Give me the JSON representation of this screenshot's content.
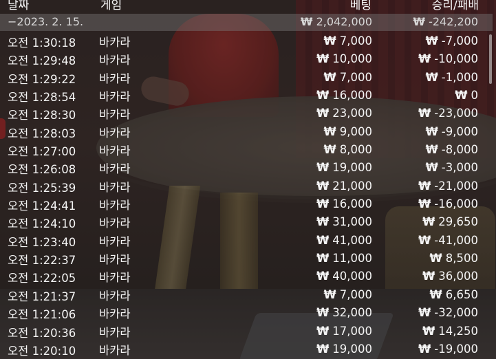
{
  "header": {
    "date_label": "날짜",
    "game_label": "게임",
    "bet_label": "베팅",
    "pl_label": "승리/패배"
  },
  "summary": {
    "date": "−2023. 2. 15.",
    "bet_currency": "₩",
    "bet": "2,042,000",
    "pl_currency": "₩",
    "pl": "-242,200"
  },
  "currency_symbol": "₩",
  "rows": [
    {
      "time": "오전 1:30:18",
      "game": "바카라",
      "bet": "7,000",
      "pl": "-7,000"
    },
    {
      "time": "오전 1:29:48",
      "game": "바카라",
      "bet": "10,000",
      "pl": "-10,000"
    },
    {
      "time": "오전 1:29:22",
      "game": "바카라",
      "bet": "7,000",
      "pl": "-1,000"
    },
    {
      "time": "오전 1:28:54",
      "game": "바카라",
      "bet": "16,000",
      "pl": "0"
    },
    {
      "time": "오전 1:28:30",
      "game": "바카라",
      "bet": "23,000",
      "pl": "-23,000"
    },
    {
      "time": "오전 1:28:03",
      "game": "바카라",
      "bet": "9,000",
      "pl": "-9,000"
    },
    {
      "time": "오전 1:27:00",
      "game": "바카라",
      "bet": "8,000",
      "pl": "-8,000"
    },
    {
      "time": "오전 1:26:08",
      "game": "바카라",
      "bet": "19,000",
      "pl": "-3,000"
    },
    {
      "time": "오전 1:25:39",
      "game": "바카라",
      "bet": "21,000",
      "pl": "-21,000"
    },
    {
      "time": "오전 1:24:41",
      "game": "바카라",
      "bet": "16,000",
      "pl": "-16,000"
    },
    {
      "time": "오전 1:24:10",
      "game": "바카라",
      "bet": "31,000",
      "pl": "29,650"
    },
    {
      "time": "오전 1:23:40",
      "game": "바카라",
      "bet": "41,000",
      "pl": "-41,000"
    },
    {
      "time": "오전 1:22:37",
      "game": "바카라",
      "bet": "11,000",
      "pl": "8,500"
    },
    {
      "time": "오전 1:22:05",
      "game": "바카라",
      "bet": "40,000",
      "pl": "36,000"
    },
    {
      "time": "오전 1:21:37",
      "game": "바카라",
      "bet": "7,000",
      "pl": "6,650"
    },
    {
      "time": "오전 1:21:06",
      "game": "바카라",
      "bet": "32,000",
      "pl": "-32,000"
    },
    {
      "time": "오전 1:20:36",
      "game": "바카라",
      "bet": "17,000",
      "pl": "14,250"
    },
    {
      "time": "오전 1:20:10",
      "game": "바카라",
      "bet": "19,000",
      "pl": "-19,000"
    }
  ]
}
